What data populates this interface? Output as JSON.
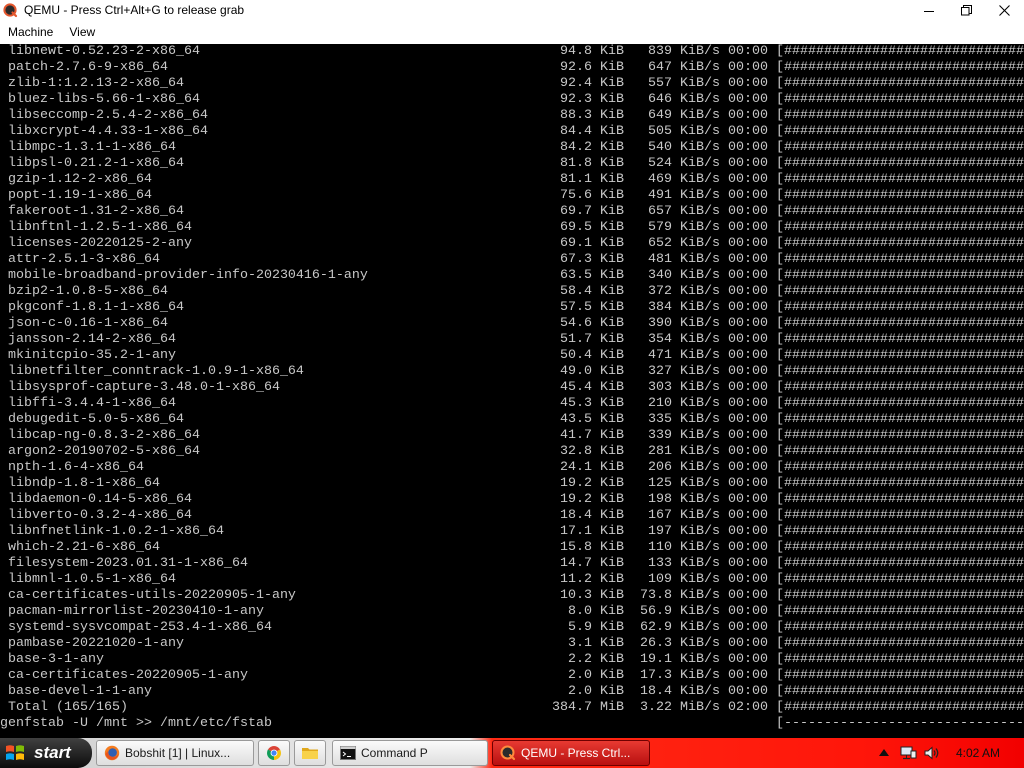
{
  "window": {
    "title": "QEMU - Press Ctrl+Alt+G to release grab",
    "icon": "qemu-icon",
    "controls": [
      "minimize-icon",
      "restore-icon",
      "close-icon"
    ]
  },
  "menubar": {
    "items": [
      {
        "label": "Machine"
      },
      {
        "label": "View"
      }
    ]
  },
  "terminal": {
    "progress_complete": "[##############################",
    "downloads": [
      {
        "name": "libnewt-0.52.23-2-x86_64",
        "size": "94.8 KiB",
        "speed": "839 KiB/s",
        "time": "00:00"
      },
      {
        "name": "patch-2.7.6-9-x86_64",
        "size": "92.6 KiB",
        "speed": "647 KiB/s",
        "time": "00:00"
      },
      {
        "name": "zlib-1:1.2.13-2-x86_64",
        "size": "92.4 KiB",
        "speed": "557 KiB/s",
        "time": "00:00"
      },
      {
        "name": "bluez-libs-5.66-1-x86_64",
        "size": "92.3 KiB",
        "speed": "646 KiB/s",
        "time": "00:00"
      },
      {
        "name": "libseccomp-2.5.4-2-x86_64",
        "size": "88.3 KiB",
        "speed": "649 KiB/s",
        "time": "00:00"
      },
      {
        "name": "libxcrypt-4.4.33-1-x86_64",
        "size": "84.4 KiB",
        "speed": "505 KiB/s",
        "time": "00:00"
      },
      {
        "name": "libmpc-1.3.1-1-x86_64",
        "size": "84.2 KiB",
        "speed": "540 KiB/s",
        "time": "00:00"
      },
      {
        "name": "libpsl-0.21.2-1-x86_64",
        "size": "81.8 KiB",
        "speed": "524 KiB/s",
        "time": "00:00"
      },
      {
        "name": "gzip-1.12-2-x86_64",
        "size": "81.1 KiB",
        "speed": "469 KiB/s",
        "time": "00:00"
      },
      {
        "name": "popt-1.19-1-x86_64",
        "size": "75.6 KiB",
        "speed": "491 KiB/s",
        "time": "00:00"
      },
      {
        "name": "fakeroot-1.31-2-x86_64",
        "size": "69.7 KiB",
        "speed": "657 KiB/s",
        "time": "00:00"
      },
      {
        "name": "libnftnl-1.2.5-1-x86_64",
        "size": "69.5 KiB",
        "speed": "579 KiB/s",
        "time": "00:00"
      },
      {
        "name": "licenses-20220125-2-any",
        "size": "69.1 KiB",
        "speed": "652 KiB/s",
        "time": "00:00"
      },
      {
        "name": "attr-2.5.1-3-x86_64",
        "size": "67.3 KiB",
        "speed": "481 KiB/s",
        "time": "00:00"
      },
      {
        "name": "mobile-broadband-provider-info-20230416-1-any",
        "size": "63.5 KiB",
        "speed": "340 KiB/s",
        "time": "00:00"
      },
      {
        "name": "bzip2-1.0.8-5-x86_64",
        "size": "58.4 KiB",
        "speed": "372 KiB/s",
        "time": "00:00"
      },
      {
        "name": "pkgconf-1.8.1-1-x86_64",
        "size": "57.5 KiB",
        "speed": "384 KiB/s",
        "time": "00:00"
      },
      {
        "name": "json-c-0.16-1-x86_64",
        "size": "54.6 KiB",
        "speed": "390 KiB/s",
        "time": "00:00"
      },
      {
        "name": "jansson-2.14-2-x86_64",
        "size": "51.7 KiB",
        "speed": "354 KiB/s",
        "time": "00:00"
      },
      {
        "name": "mkinitcpio-35.2-1-any",
        "size": "50.4 KiB",
        "speed": "471 KiB/s",
        "time": "00:00"
      },
      {
        "name": "libnetfilter_conntrack-1.0.9-1-x86_64",
        "size": "49.0 KiB",
        "speed": "327 KiB/s",
        "time": "00:00"
      },
      {
        "name": "libsysprof-capture-3.48.0-1-x86_64",
        "size": "45.4 KiB",
        "speed": "303 KiB/s",
        "time": "00:00"
      },
      {
        "name": "libffi-3.4.4-1-x86_64",
        "size": "45.3 KiB",
        "speed": "210 KiB/s",
        "time": "00:00"
      },
      {
        "name": "debugedit-5.0-5-x86_64",
        "size": "43.5 KiB",
        "speed": "335 KiB/s",
        "time": "00:00"
      },
      {
        "name": "libcap-ng-0.8.3-2-x86_64",
        "size": "41.7 KiB",
        "speed": "339 KiB/s",
        "time": "00:00"
      },
      {
        "name": "argon2-20190702-5-x86_64",
        "size": "32.8 KiB",
        "speed": "281 KiB/s",
        "time": "00:00"
      },
      {
        "name": "npth-1.6-4-x86_64",
        "size": "24.1 KiB",
        "speed": "206 KiB/s",
        "time": "00:00"
      },
      {
        "name": "libndp-1.8-1-x86_64",
        "size": "19.2 KiB",
        "speed": "125 KiB/s",
        "time": "00:00"
      },
      {
        "name": "libdaemon-0.14-5-x86_64",
        "size": "19.2 KiB",
        "speed": "198 KiB/s",
        "time": "00:00"
      },
      {
        "name": "libverto-0.3.2-4-x86_64",
        "size": "18.4 KiB",
        "speed": "167 KiB/s",
        "time": "00:00"
      },
      {
        "name": "libnfnetlink-1.0.2-1-x86_64",
        "size": "17.1 KiB",
        "speed": "197 KiB/s",
        "time": "00:00"
      },
      {
        "name": "which-2.21-6-x86_64",
        "size": "15.8 KiB",
        "speed": "110 KiB/s",
        "time": "00:00"
      },
      {
        "name": "filesystem-2023.01.31-1-x86_64",
        "size": "14.7 KiB",
        "speed": "133 KiB/s",
        "time": "00:00"
      },
      {
        "name": "libmnl-1.0.5-1-x86_64",
        "size": "11.2 KiB",
        "speed": "109 KiB/s",
        "time": "00:00"
      },
      {
        "name": "ca-certificates-utils-20220905-1-any",
        "size": "10.3 KiB",
        "speed": "73.8 KiB/s",
        "time": "00:00"
      },
      {
        "name": "pacman-mirrorlist-20230410-1-any",
        "size": "8.0 KiB",
        "speed": "56.9 KiB/s",
        "time": "00:00"
      },
      {
        "name": "systemd-sysvcompat-253.4-1-x86_64",
        "size": "5.9 KiB",
        "speed": "62.9 KiB/s",
        "time": "00:00"
      },
      {
        "name": "pambase-20221020-1-any",
        "size": "3.1 KiB",
        "speed": "26.3 KiB/s",
        "time": "00:00"
      },
      {
        "name": "base-3-1-any",
        "size": "2.2 KiB",
        "speed": "19.1 KiB/s",
        "time": "00:00"
      },
      {
        "name": "ca-certificates-20220905-1-any",
        "size": "2.0 KiB",
        "speed": "17.3 KiB/s",
        "time": "00:00"
      },
      {
        "name": "base-devel-1-1-any",
        "size": "2.0 KiB",
        "speed": "18.4 KiB/s",
        "time": "00:00"
      }
    ],
    "total": {
      "label": "Total (165/165)",
      "size": "384.7 MiB",
      "speed": "3.22 MiB/s",
      "time": "02:00"
    },
    "command": {
      "text": "genfstab -U /mnt >> /mnt/etc/fstab",
      "progress": "[------------------------------"
    }
  },
  "taskbar": {
    "start": {
      "label": "start",
      "icon": "windows-logo-icon"
    },
    "buttons": [
      {
        "label": "Bobshit [1] | Linux...",
        "icon": "firefox-icon",
        "active": false
      },
      {
        "icon": "chrome-icon",
        "active": false
      },
      {
        "icon": "folder-icon",
        "active": false
      },
      {
        "label": "Command P",
        "icon": "command-prompt-icon",
        "active": false
      },
      {
        "label": "QEMU - Press Ctrl...",
        "icon": "qemu-icon",
        "active": true
      }
    ],
    "tray": {
      "icons": [
        "show-hidden-icons-icon",
        "network-icon",
        "volume-icon"
      ],
      "clock": "4:02 AM"
    }
  },
  "colors": {
    "terminal_text": "#c8c8c8",
    "terminal_background": "#000000",
    "titlebar_background": "#ffffff",
    "taskbar_red": "#ff160a",
    "active_task_button": "#c81414"
  }
}
